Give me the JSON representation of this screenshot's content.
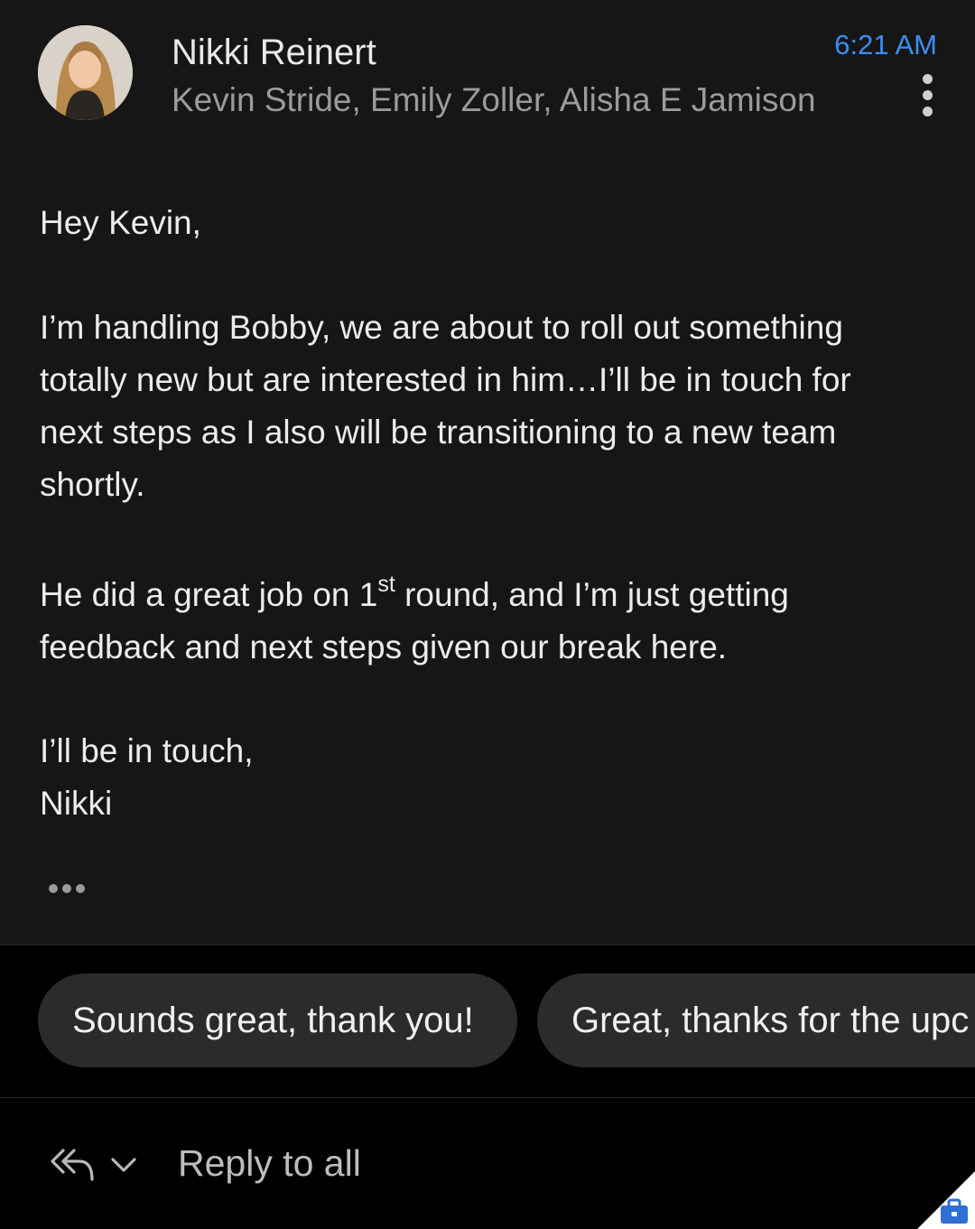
{
  "header": {
    "sender_name": "Nikki Reinert",
    "recipients": "Kevin Stride, Emily Zoller, Alisha E Jamison",
    "time": "6:21 AM"
  },
  "body": {
    "greeting": "Hey Kevin,",
    "paragraph1_line1": "I’m handling Bobby, we are about to roll out something",
    "paragraph1_line2": "totally new but are interested in him…I’ll be in touch for",
    "paragraph1_line3": "next steps as I also will be transitioning to a new team",
    "paragraph1_line4": "shortly.",
    "paragraph2_line1_before": "He did a great job on 1",
    "paragraph2_line1_sup": "st",
    "paragraph2_line1_after": " round, and I’m just getting",
    "paragraph2_line2": "feedback and next steps given our break here.",
    "closing": "I’ll be in touch,",
    "signature": "Nikki"
  },
  "smart_replies": [
    {
      "label": "Sounds great, thank you!"
    },
    {
      "label": "Great, thanks for the upc"
    }
  ],
  "footer": {
    "reply_all_label": "Reply to all"
  },
  "colors": {
    "accent": "#3d8ef3",
    "message_bg": "#161616",
    "chip_bg": "#2b2b2b",
    "briefcase": "#2f6fd6"
  },
  "icons": [
    "more-vert-icon",
    "reply-all-icon",
    "chevron-down-icon",
    "briefcase-icon",
    "ellipsis-icon"
  ]
}
